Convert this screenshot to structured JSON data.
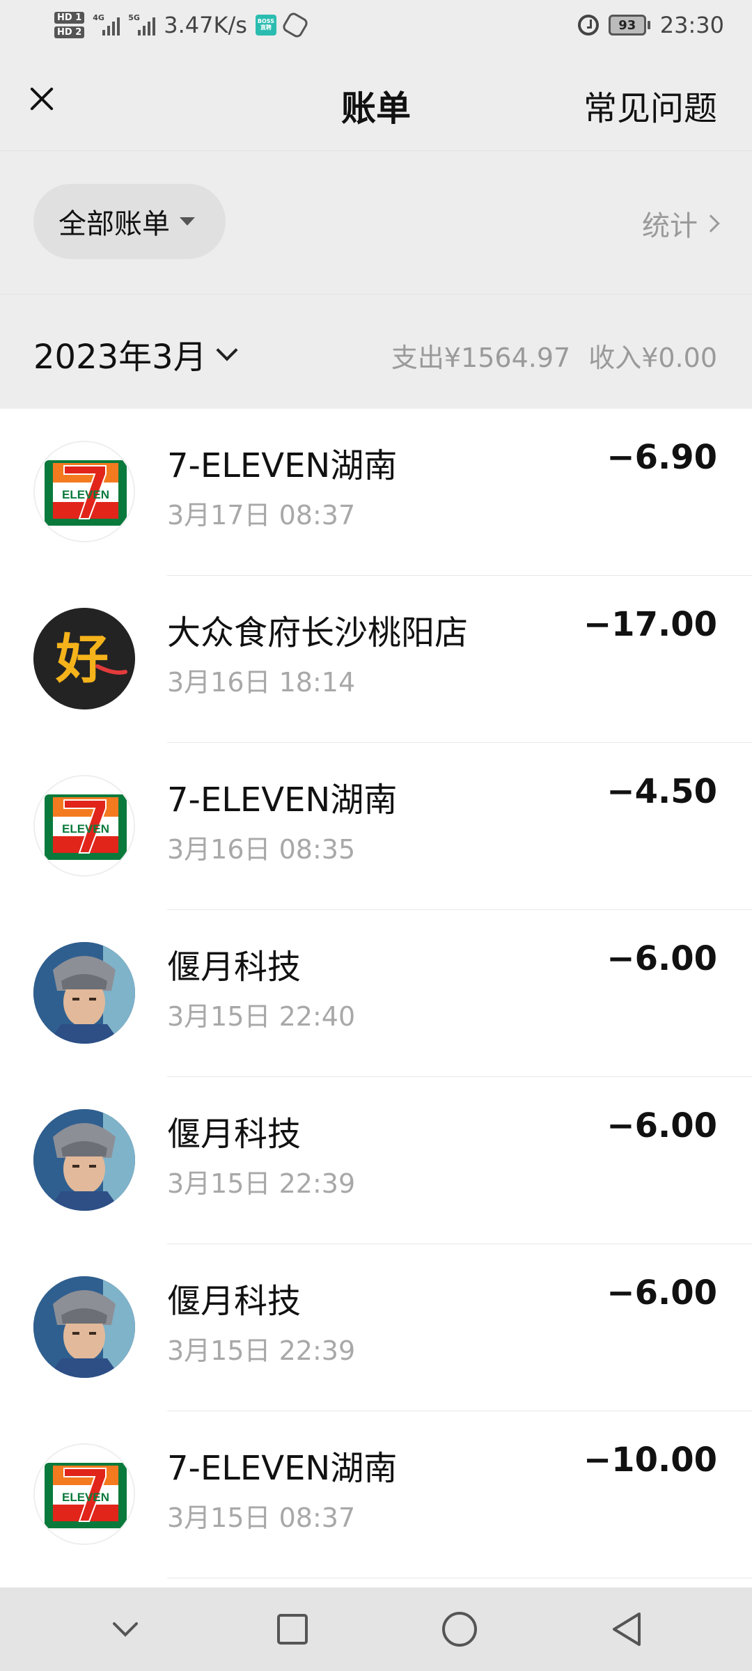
{
  "status_bar": {
    "hd1": "HD 1",
    "hd2": "HD 2",
    "net1": "4G",
    "net2": "5G",
    "speed": "3.47K/s",
    "boss_line1": "BOSS",
    "boss_line2": "直聘",
    "battery": "93",
    "time": "23:30"
  },
  "header": {
    "title": "账单",
    "faq_label": "常见问题"
  },
  "filter": {
    "label": "全部账单",
    "stats_label": "统计"
  },
  "month": {
    "label": "2023年3月",
    "expense": "支出¥1564.97",
    "income": "收入¥0.00"
  },
  "transactions": [
    {
      "merchant": "7-ELEVEN湖南",
      "time": "3月17日 08:37",
      "amount": "−6.90",
      "icon": "seven-eleven-logo"
    },
    {
      "merchant": "大众食府长沙桃阳店",
      "time": "3月16日 18:14",
      "amount": "−17.00",
      "icon": "hao-logo"
    },
    {
      "merchant": "7-ELEVEN湖南",
      "time": "3月16日 08:35",
      "amount": "−4.50",
      "icon": "seven-eleven-logo"
    },
    {
      "merchant": "偃月科技",
      "time": "3月15日 22:40",
      "amount": "−6.00",
      "icon": "game-avatar"
    },
    {
      "merchant": "偃月科技",
      "time": "3月15日 22:39",
      "amount": "−6.00",
      "icon": "game-avatar"
    },
    {
      "merchant": "偃月科技",
      "time": "3月15日 22:39",
      "amount": "−6.00",
      "icon": "game-avatar"
    },
    {
      "merchant": "7-ELEVEN湖南",
      "time": "3月15日 08:37",
      "amount": "−10.00",
      "icon": "seven-eleven-logo"
    }
  ],
  "logos": {
    "seven_eleven_text": "ELEVEN",
    "hao_text": "好"
  },
  "nav": {
    "icons": [
      "chevron-down-icon",
      "square-icon",
      "circle-icon",
      "back-triangle-icon"
    ]
  },
  "colors": {
    "background": "#ededed",
    "list_bg": "#ffffff",
    "muted": "#9a9a9a",
    "seven_green": "#0a7a3c",
    "seven_orange": "#f47a20",
    "seven_red": "#e1251b"
  }
}
